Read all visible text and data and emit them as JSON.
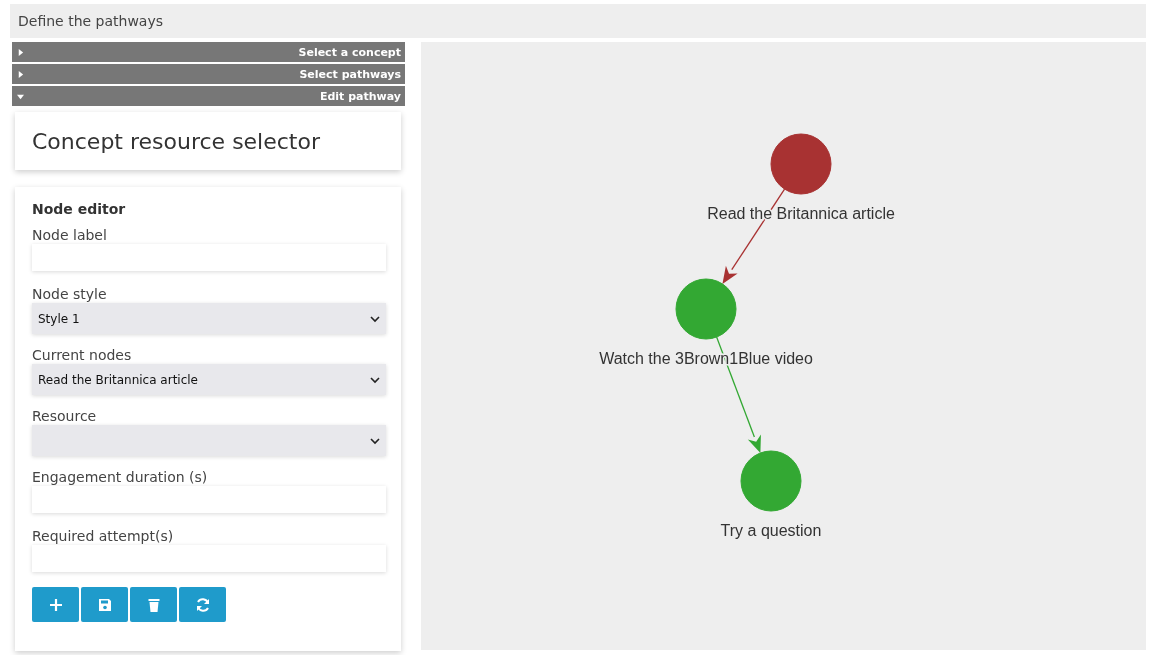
{
  "header": {
    "title": "Define the pathways"
  },
  "sections": [
    {
      "label": "Select a concept",
      "expanded": false
    },
    {
      "label": "Select pathways",
      "expanded": false
    },
    {
      "label": "Edit pathway",
      "expanded": true
    }
  ],
  "resource_card": {
    "title": "Concept resource selector"
  },
  "node_editor": {
    "title": "Node editor",
    "fields": [
      {
        "kind": "text",
        "label": "Node label"
      },
      {
        "kind": "select",
        "label": "Node style",
        "value": "Style 1"
      },
      {
        "kind": "select",
        "label": "Current nodes",
        "value": "Read the Britannica article"
      },
      {
        "kind": "select",
        "label": "Resource"
      },
      {
        "kind": "text",
        "label": "Engagement duration (s)"
      },
      {
        "kind": "text",
        "label": "Required attempt(s)"
      }
    ],
    "buttons": [
      {
        "kind": "add"
      },
      {
        "kind": "save"
      },
      {
        "kind": "delete"
      },
      {
        "kind": "refresh"
      }
    ]
  },
  "graph": {
    "nodes": [
      {
        "label": "Read the Britannica article",
        "color": "#a83232"
      },
      {
        "label": "Watch the 3Brown1Blue video",
        "color": "#33a833"
      },
      {
        "label": "Try a question",
        "color": "#33a833"
      }
    ],
    "edges": [
      {
        "color": "#a83232"
      },
      {
        "color": "#33a833"
      }
    ]
  }
}
